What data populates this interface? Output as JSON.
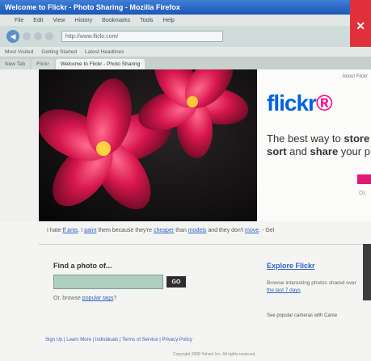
{
  "window": {
    "title": "Welcome to Flickr - Photo Sharing - Mozilla Firefox",
    "close_glyph": "✕"
  },
  "menu": [
    "File",
    "Edit",
    "View",
    "History",
    "Bookmarks",
    "Tools",
    "Help"
  ],
  "nav": {
    "back_glyph": "◀",
    "url": "http://www.flickr.com/"
  },
  "bookmarks": [
    "Most Visited",
    "Getting Started",
    "Latest Headlines"
  ],
  "tabs": [
    "New Tab",
    "Flickr",
    "Welcome to Flickr - Photo Sharing"
  ],
  "promo": {
    "about_link": "About Flickr",
    "logo_main": "flickr",
    "logo_suffix": "®",
    "tagline_prefix": "The best way to ",
    "tagline_bold1": "store",
    "tagline_line2_bold": "sort",
    "tagline_line2_mid": " and ",
    "tagline_line2_bold2": "share",
    "tagline_line2_end": " your p",
    "or_text": "Or,"
  },
  "caption": {
    "p1": "I hate ",
    "l1": "ff ants",
    "p2": ". I ",
    "l2": "paint",
    "p3": " them because they're ",
    "l3": "cheaper",
    "p4": " than ",
    "l4": "models",
    "p5": " and they don't ",
    "l5": "move",
    "p6": ". - Gel"
  },
  "find": {
    "title": "Find a photo of...",
    "go_label": "GO",
    "browse_prefix": "Or, browse ",
    "browse_link": "popular tags",
    "browse_suffix": "?"
  },
  "explore": {
    "title": "Explore Flickr",
    "text_prefix": "Browse interesting photos shared over ",
    "text_link": "the last 7 days",
    "cameras": "See popular cameras with Came"
  },
  "footer": {
    "links": "Sign Up | Learn More | Individuals | Terms of Service | Privacy Policy",
    "copyright": "Copyright 2008 Yahoo! Inc. All rights reserved."
  },
  "colors": {
    "flickr_blue": "#0063dc",
    "flickr_pink": "#ff0084",
    "close_red": "#e0303a",
    "link_blue": "#2f62c5"
  }
}
